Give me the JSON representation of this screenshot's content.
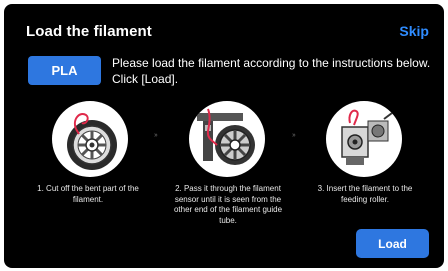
{
  "header": {
    "title": "Load the filament",
    "skip_label": "Skip"
  },
  "filament": {
    "type_label": "PLA"
  },
  "instruction": {
    "line1": "Please load the filament according to the instructions below.",
    "line2": "Click [Load]."
  },
  "steps": [
    {
      "text": "1. Cut off the bent part  of the filament.",
      "icon": "spool-cut-icon"
    },
    {
      "text": "2. Pass it through the filament sensor until it is seen from the other end of the filament guide tube.",
      "icon": "filament-sensor-icon"
    },
    {
      "text": "3. Insert the filament to the feeding roller.",
      "icon": "feeding-roller-icon"
    }
  ],
  "step_separator": "››",
  "actions": {
    "load_label": "Load"
  },
  "colors": {
    "background": "#000000",
    "accent": "#2e77e0",
    "skip": "#2f8cff",
    "filament": "#e0294a"
  }
}
